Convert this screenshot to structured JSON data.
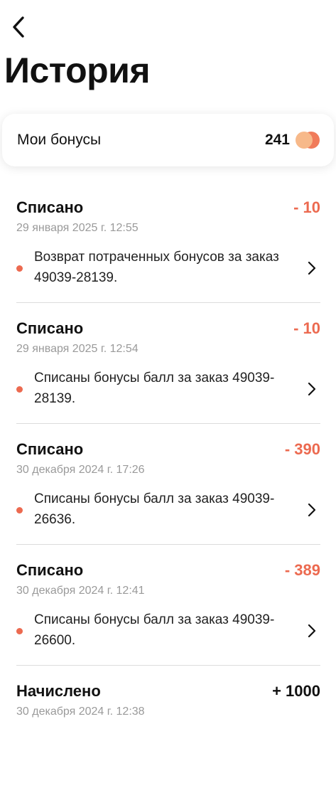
{
  "header": {
    "title": "История",
    "back_icon": "chevron-left-icon"
  },
  "bonus_card": {
    "label": "Мои бонусы",
    "value": "241",
    "icon": "coins-icon"
  },
  "colors": {
    "accent": "#ec6a50",
    "coin_light": "#f7b98a",
    "coin_dark": "#f07b5a",
    "muted_text": "#9a9a9a",
    "divider": "#dcdcdc"
  },
  "entries": [
    {
      "type": "Списано",
      "amount": "- 10",
      "sign": "neg",
      "date": "29 января 2025 г. 12:55",
      "description": "Возврат потраченных бонусов за заказ 49039-28139."
    },
    {
      "type": "Списано",
      "amount": "- 10",
      "sign": "neg",
      "date": "29 января 2025 г. 12:54",
      "description": "Списаны бонусы балл за заказ 49039-28139."
    },
    {
      "type": "Списано",
      "amount": "- 390",
      "sign": "neg",
      "date": "30 декабря 2024 г. 17:26",
      "description": "Списаны бонусы балл за заказ 49039-26636."
    },
    {
      "type": "Списано",
      "amount": "- 389",
      "sign": "neg",
      "date": "30 декабря 2024 г. 12:41",
      "description": "Списаны бонусы балл за заказ 49039-26600."
    },
    {
      "type": "Начислено",
      "amount": "+ 1000",
      "sign": "pos",
      "date": "30 декабря 2024 г. 12:38",
      "description": ""
    }
  ]
}
